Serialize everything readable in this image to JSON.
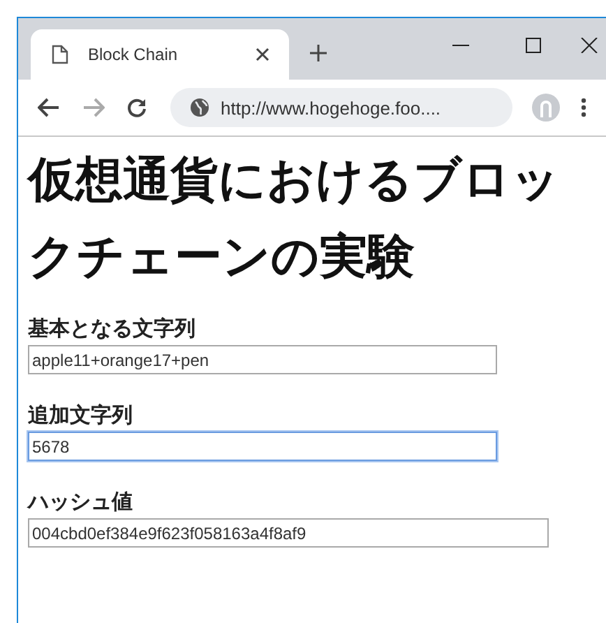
{
  "browser": {
    "tab": {
      "title": "Block Chain",
      "selected": true
    },
    "address": "http://www.hogehoge.foo...."
  },
  "page": {
    "heading": "仮想通貨におけるブロックチェーンの実験",
    "fields": [
      {
        "label": "基本となる文字列",
        "value": "apple11+orange17+pen",
        "focused": false,
        "kind": "normal"
      },
      {
        "label": "追加文字列",
        "value": "5678",
        "focused": true,
        "kind": "normal"
      },
      {
        "label": "ハッシュ値",
        "value": "004cbd0ef384e9f623f058163a4f8af9",
        "focused": false,
        "kind": "wide"
      }
    ]
  }
}
